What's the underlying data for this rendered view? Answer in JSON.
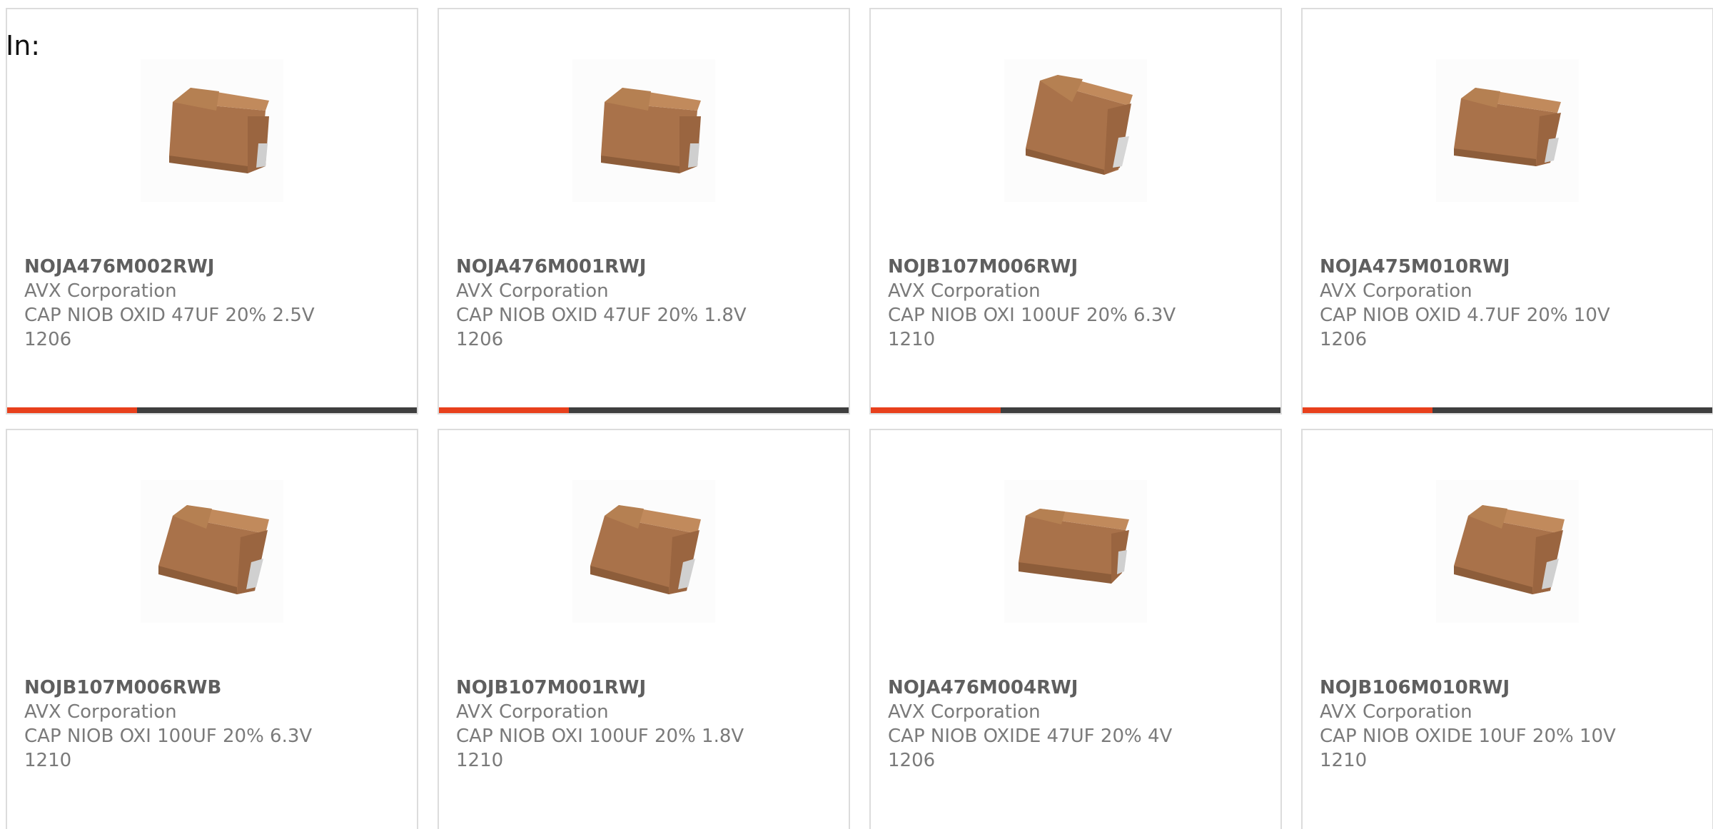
{
  "filter_label": "In:",
  "colors": {
    "accent": "#e8401c",
    "bar": "#3f3f3f",
    "border": "#dcdcdc",
    "chip_body": "#b07a4a"
  },
  "products": [
    {
      "part": "NOJA476M002RWJ",
      "manufacturer": "AVX Corporation",
      "description": "CAP NIOB OXID 47UF 20% 2.5V",
      "package": "1206",
      "image": "capacitor-chip-image"
    },
    {
      "part": "NOJA476M001RWJ",
      "manufacturer": "AVX Corporation",
      "description": "CAP NIOB OXID 47UF 20% 1.8V",
      "package": "1206",
      "image": "capacitor-chip-image"
    },
    {
      "part": "NOJB107M006RWJ",
      "manufacturer": "AVX Corporation",
      "description": "CAP NIOB OXI 100UF 20% 6.3V",
      "package": "1210",
      "image": "capacitor-chip-image"
    },
    {
      "part": "NOJA475M010RWJ",
      "manufacturer": "AVX Corporation",
      "description": "CAP NIOB OXID 4.7UF 20% 10V",
      "package": "1206",
      "image": "capacitor-chip-image"
    },
    {
      "part": "NOJB107M006RWB",
      "manufacturer": "AVX Corporation",
      "description": "CAP NIOB OXI 100UF 20% 6.3V",
      "package": "1210",
      "image": "capacitor-chip-image"
    },
    {
      "part": "NOJB107M001RWJ",
      "manufacturer": "AVX Corporation",
      "description": "CAP NIOB OXI 100UF 20% 1.8V",
      "package": "1210",
      "image": "capacitor-chip-image"
    },
    {
      "part": "NOJA476M004RWJ",
      "manufacturer": "AVX Corporation",
      "description": "CAP NIOB OXIDE 47UF 20% 4V",
      "package": "1206",
      "image": "capacitor-chip-image"
    },
    {
      "part": "NOJB106M010RWJ",
      "manufacturer": "AVX Corporation",
      "description": "CAP NIOB OXIDE 10UF 20% 10V",
      "package": "1210",
      "image": "capacitor-chip-image"
    }
  ]
}
